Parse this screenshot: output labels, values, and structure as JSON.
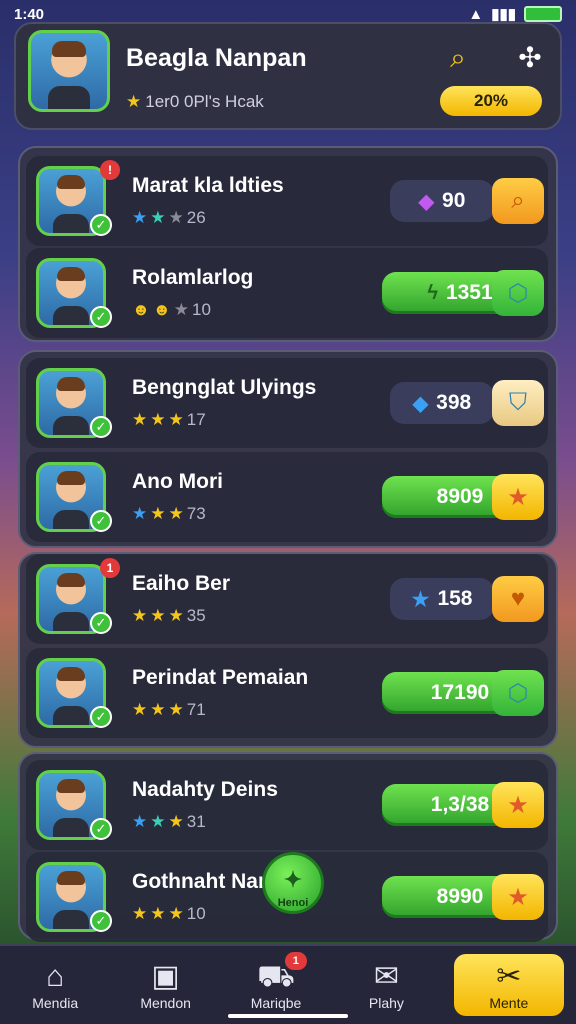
{
  "status": {
    "time": "1:40"
  },
  "header": {
    "name": "Beagla Nanpan",
    "sub": "1er0 0Pl's Hcak",
    "percent": "20%",
    "search_icon": "search-icon",
    "settings_icon": "gear-icon"
  },
  "players": [
    {
      "name": "Marat kla ldties",
      "rating": "26",
      "stars": [
        "blue",
        "teal",
        "gray"
      ],
      "value": "90",
      "value_style": "dark",
      "gem_icon": "purple-gem-icon",
      "action": "orange",
      "action_icon": "magnify-icon",
      "alert": "!"
    },
    {
      "name": "Rolamlarlog",
      "rating": "10",
      "stars": [
        "mask",
        "mask",
        "gray"
      ],
      "value": "1351",
      "value_style": "green",
      "gem_icon": "bolt-icon",
      "action": "teal",
      "action_icon": "hexagon-icon",
      "alert": ""
    },
    {
      "name": "Bengnglat Ulyings",
      "rating": "17",
      "stars": [
        "gold",
        "gold",
        "gold"
      ],
      "value": "398",
      "value_style": "dark",
      "gem_icon": "blue-gem-icon",
      "action": "cream",
      "action_icon": "shield-icon",
      "alert": ""
    },
    {
      "name": "Ano Mori",
      "rating": "73",
      "stars": [
        "blue",
        "gold",
        "gold"
      ],
      "value": "8909",
      "value_style": "green",
      "gem_icon": "",
      "action": "yellow",
      "action_icon": "star-icon",
      "alert": ""
    },
    {
      "name": "Eaiho Ber",
      "rating": "35",
      "stars": [
        "gold",
        "gold",
        "gold"
      ],
      "value": "158",
      "value_style": "dark",
      "gem_icon": "blue-star-icon",
      "action": "orange",
      "action_icon": "heart-icon",
      "alert": "1"
    },
    {
      "name": "Perindat Pemaian",
      "rating": "71",
      "stars": [
        "gold",
        "gold",
        "gold"
      ],
      "value": "17190",
      "value_style": "green",
      "gem_icon": "",
      "action": "teal",
      "action_icon": "hexagon-icon",
      "alert": ""
    },
    {
      "name": "Nadahty Deins",
      "rating": "31",
      "stars": [
        "blue",
        "teal",
        "gold"
      ],
      "value": "1,3/38",
      "value_style": "green",
      "gem_icon": "",
      "action": "yellow",
      "action_icon": "star-icon",
      "alert": ""
    },
    {
      "name": "Gothnaht Nan",
      "rating": "10",
      "stars": [
        "gold",
        "gold",
        "gold"
      ],
      "value": "8990",
      "value_style": "green",
      "gem_icon": "",
      "action": "yellow",
      "action_icon": "star-icon",
      "alert": ""
    }
  ],
  "fab": {
    "label": "Henoi"
  },
  "nav": [
    {
      "label": "Mendia",
      "icon": "home-icon",
      "badge": ""
    },
    {
      "label": "Mendon",
      "icon": "shop-icon",
      "badge": ""
    },
    {
      "label": "Mariqbe",
      "icon": "map-icon",
      "badge": "1"
    },
    {
      "label": "Plahy",
      "icon": "chat-icon",
      "badge": ""
    },
    {
      "label": "Mente",
      "icon": "tools-icon",
      "badge": ""
    }
  ]
}
